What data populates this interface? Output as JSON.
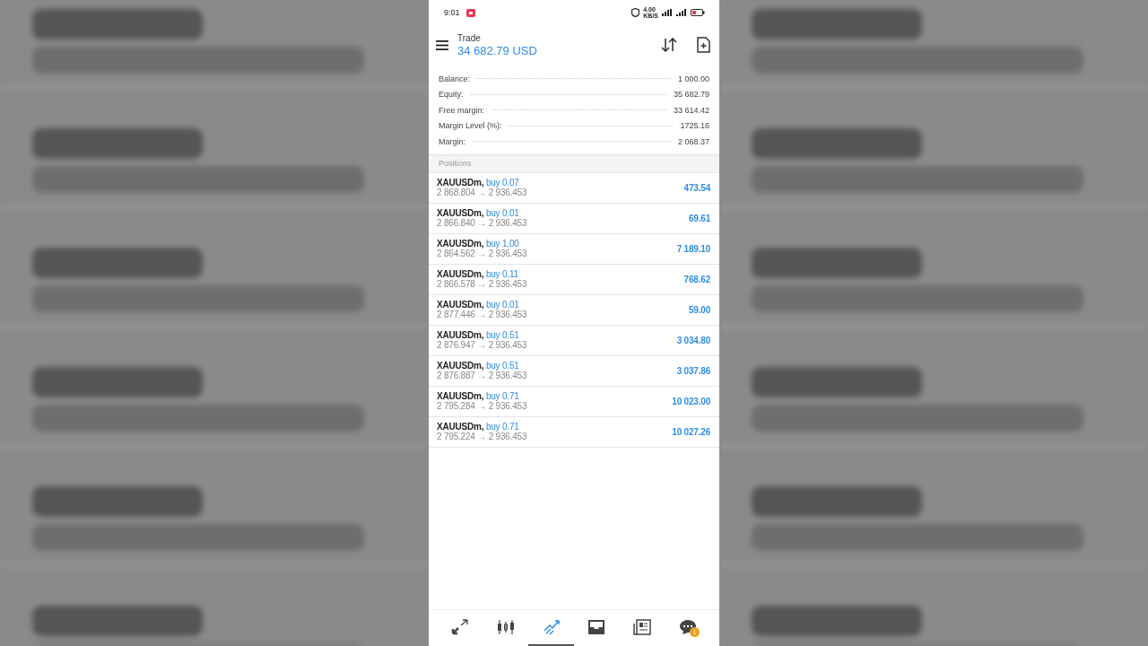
{
  "status_bar": {
    "time": "9:01",
    "speed": "4.00",
    "speed_unit": "KB/S"
  },
  "header": {
    "title": "Trade",
    "balance": "34 682.79 USD"
  },
  "summary": [
    {
      "label": "Balance:",
      "value": "1 000.00"
    },
    {
      "label": "Equity:",
      "value": "35 682.79"
    },
    {
      "label": "Free margin:",
      "value": "33 614.42"
    },
    {
      "label": "Margin Level (%):",
      "value": "1725.16"
    },
    {
      "label": "Margin:",
      "value": "2 068.37"
    }
  ],
  "positions": {
    "title": "Positions",
    "rows": [
      {
        "symbol": "XAUUSDm,",
        "side": "buy 0.07",
        "prices": "2 868.804 → 2 936.453",
        "profit": "473.54"
      },
      {
        "symbol": "XAUUSDm,",
        "side": "buy 0.01",
        "prices": "2 866.840 → 2 936.453",
        "profit": "69.61"
      },
      {
        "symbol": "XAUUSDm,",
        "side": "buy 1.00",
        "prices": "2 864.562 → 2 936.453",
        "profit": "7 189.10"
      },
      {
        "symbol": "XAUUSDm,",
        "side": "buy 0.11",
        "prices": "2 866.578 → 2 936.453",
        "profit": "768.62"
      },
      {
        "symbol": "XAUUSDm,",
        "side": "buy 0.01",
        "prices": "2 877.446 → 2 936.453",
        "profit": "59.00"
      },
      {
        "symbol": "XAUUSDm,",
        "side": "buy 0.51",
        "prices": "2 876.947 → 2 936.453",
        "profit": "3 034.80"
      },
      {
        "symbol": "XAUUSDm,",
        "side": "buy 0.51",
        "prices": "2 876.887 → 2 936.453",
        "profit": "3 037.86"
      },
      {
        "symbol": "XAUUSDm,",
        "side": "buy 0.71",
        "prices": "2 795.284 → 2 936.453",
        "profit": "10 023.00"
      },
      {
        "symbol": "XAUUSDm,",
        "side": "buy 0.71",
        "prices": "2 795.224 → 2 936.453",
        "profit": "10 027.26"
      }
    ]
  },
  "bottom_nav": [
    {
      "kind": "quotes",
      "selected": false
    },
    {
      "kind": "chart",
      "selected": false
    },
    {
      "kind": "trade",
      "selected": true
    },
    {
      "kind": "history",
      "selected": false
    },
    {
      "kind": "news",
      "selected": false
    },
    {
      "kind": "messages",
      "selected": false,
      "badge": "1"
    }
  ]
}
